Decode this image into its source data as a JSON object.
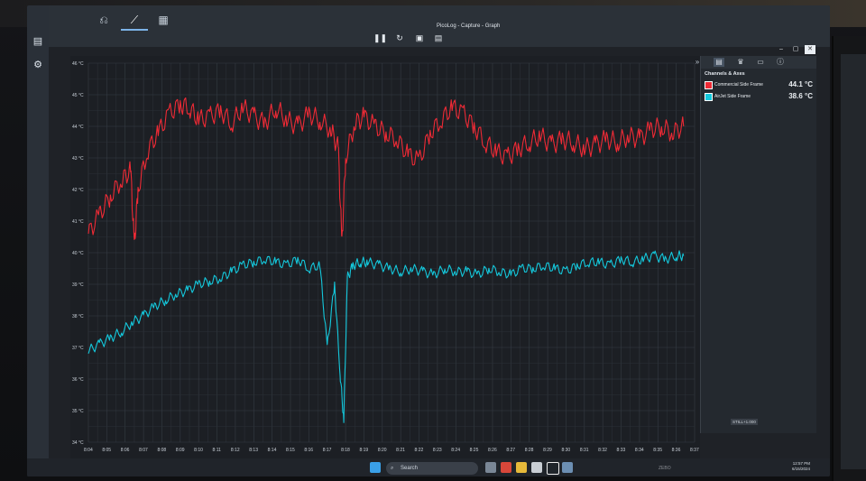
{
  "window": {
    "title": "PicoLog - Capture - Graph"
  },
  "modes": [
    {
      "name": "usb-icon",
      "glyph": "⎌"
    },
    {
      "name": "graph-icon",
      "glyph": "⟋"
    },
    {
      "name": "table-icon",
      "glyph": "▦"
    }
  ],
  "capture_controls": [
    "pause-icon",
    "refresh-icon",
    "save-icon",
    "save-as-icon"
  ],
  "right_panel": {
    "title": "Channels & Axes",
    "channels": [
      {
        "name": "Commercial Side Frame",
        "value": "44.1 °C",
        "color": "#ee2a35"
      },
      {
        "name": "AirJet Side Frame",
        "value": "38.6 °C",
        "color": "#14c8dc"
      }
    ]
  },
  "chart_data": {
    "type": "line",
    "y_ticks": [
      "46 °C",
      "45 °C",
      "44 °C",
      "43 °C",
      "42 °C",
      "41 °C",
      "40 °C",
      "39 °C",
      "38 °C",
      "37 °C",
      "36 °C",
      "35 °C",
      "34 °C"
    ],
    "x_ticks": [
      "8:04",
      "8:05",
      "8:06",
      "8:07",
      "8:08",
      "8:09",
      "8:10",
      "8:11",
      "8:12",
      "8:13",
      "8:14",
      "8:15",
      "8:16",
      "8:17",
      "8:18",
      "8:19",
      "8:20",
      "8:21",
      "8:22",
      "8:23",
      "8:24",
      "8:25",
      "8:26",
      "8:27",
      "8:28",
      "8:29",
      "8:30",
      "8:31",
      "8:32",
      "8:33",
      "8:34",
      "8:35",
      "8:36",
      "8:37"
    ],
    "ylim": [
      34,
      46
    ],
    "x_range_minutes": [
      0,
      33
    ],
    "grid": true,
    "series": [
      {
        "name": "Commercial Side Frame",
        "color": "#ee2a35",
        "x": [
          0,
          0.6,
          1.2,
          1.8,
          2.3,
          2.5,
          2.7,
          3.2,
          3.8,
          4.4,
          5.0,
          5.5,
          6.0,
          6.6,
          7.2,
          7.8,
          8.4,
          9.0,
          9.6,
          10.2,
          10.8,
          11.4,
          12.0,
          12.6,
          13.2,
          13.6,
          13.8,
          14.0,
          14.5,
          15.0,
          15.6,
          16.2,
          16.8,
          17.4,
          18.0,
          18.6,
          19.2,
          19.8,
          20.4,
          21.0,
          21.6,
          22.2,
          22.8,
          23.4,
          24.0,
          24.6,
          25.2,
          25.8,
          26.4,
          27.0,
          27.6,
          28.2,
          28.8,
          29.4,
          30.0,
          30.6,
          31.2,
          31.8,
          32.4
        ],
        "values": [
          40.6,
          41.2,
          41.8,
          42.3,
          42.6,
          40.2,
          42.0,
          43.2,
          43.8,
          44.4,
          44.7,
          44.6,
          44.2,
          44.3,
          44.5,
          44.1,
          44.6,
          44.3,
          44.1,
          44.6,
          44.2,
          44.0,
          44.4,
          44.2,
          43.9,
          43.3,
          40.3,
          43.0,
          44.1,
          44.3,
          44.0,
          43.8,
          43.6,
          43.1,
          42.9,
          43.8,
          44.2,
          44.6,
          44.4,
          44.0,
          43.5,
          43.2,
          43.0,
          43.3,
          43.5,
          43.7,
          43.4,
          43.6,
          43.5,
          43.3,
          43.4,
          43.6,
          43.5,
          43.7,
          43.6,
          43.9,
          44.0,
          43.8,
          44.0
        ]
      },
      {
        "name": "AirJet Side Frame",
        "color": "#14c8dc",
        "x": [
          0,
          0.6,
          1.2,
          1.8,
          2.4,
          3.0,
          3.6,
          4.2,
          4.8,
          5.4,
          6.0,
          6.6,
          7.2,
          7.8,
          8.4,
          9.0,
          9.6,
          10.2,
          10.8,
          11.4,
          12.0,
          12.6,
          13.0,
          13.4,
          13.7,
          13.9,
          14.1,
          14.4,
          14.8,
          15.2,
          15.8,
          16.4,
          17.0,
          17.6,
          18.2,
          18.8,
          19.4,
          20.0,
          20.6,
          21.2,
          21.8,
          22.4,
          23.0,
          23.6,
          24.2,
          24.8,
          25.4,
          26.0,
          26.6,
          27.2,
          27.8,
          28.4,
          29.0,
          29.6,
          30.2,
          30.8,
          31.4,
          32.0,
          32.4
        ],
        "values": [
          36.9,
          37.1,
          37.3,
          37.5,
          37.8,
          38.0,
          38.3,
          38.5,
          38.7,
          38.8,
          39.0,
          39.1,
          39.2,
          39.4,
          39.6,
          39.7,
          39.8,
          39.7,
          39.6,
          39.8,
          39.5,
          39.6,
          37.0,
          39.0,
          36.2,
          34.7,
          39.2,
          39.6,
          39.7,
          39.7,
          39.6,
          39.5,
          39.4,
          39.5,
          39.4,
          39.3,
          39.5,
          39.4,
          39.4,
          39.3,
          39.5,
          39.4,
          39.3,
          39.5,
          39.5,
          39.6,
          39.5,
          39.4,
          39.6,
          39.7,
          39.7,
          39.6,
          39.8,
          39.7,
          39.8,
          39.9,
          39.8,
          39.9,
          39.9
        ]
      }
    ]
  },
  "status": {
    "badge": "STILL+1.000"
  },
  "taskbar": {
    "search_placeholder": "Search",
    "time": "12:57 PM",
    "date": "6/15/2024",
    "bottom_label": "ZEBO"
  }
}
